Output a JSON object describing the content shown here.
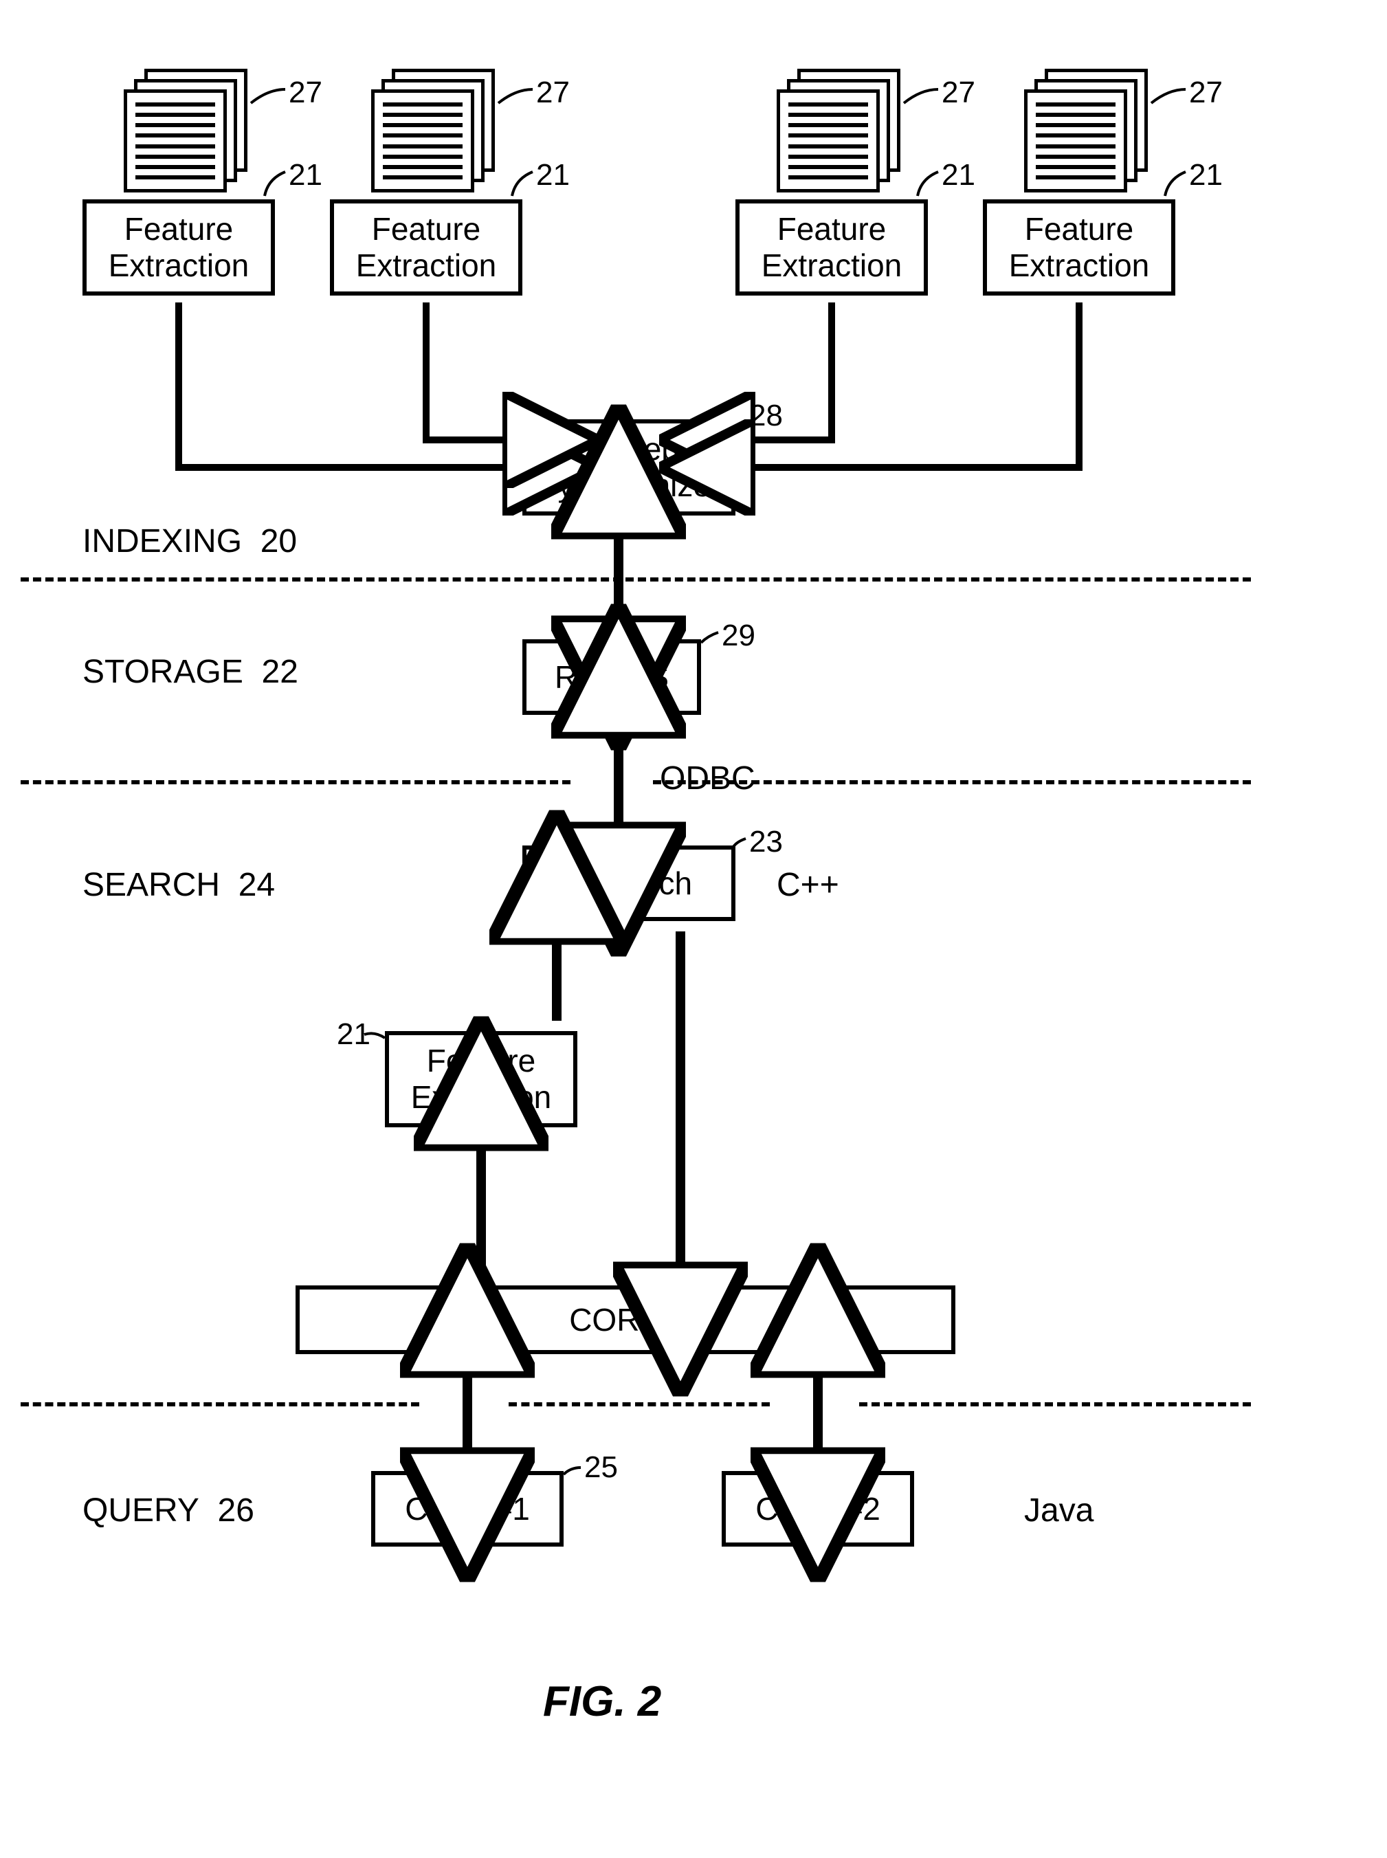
{
  "figure_caption": "FIG. 2",
  "sections": {
    "indexing": {
      "label": "INDEXING",
      "num": "20"
    },
    "storage": {
      "label": "STORAGE",
      "num": "22"
    },
    "search": {
      "label": "SEARCH",
      "num": "24"
    },
    "query": {
      "label": "QUERY",
      "num": "26"
    }
  },
  "boxes": {
    "feature_extraction": "Feature\nExtraction",
    "concept_sync": "Concept\nSynchronizer",
    "rdbms": "RDBMS",
    "ii_search": "II Search",
    "corba": "CORBA",
    "client1": "Client #1",
    "client2": "Client #2"
  },
  "refs": {
    "fe": "21",
    "docs": "27",
    "concept": "28",
    "rdbms": "29",
    "ii": "23",
    "client": "25"
  },
  "annotations": {
    "odbc": "ODBC",
    "cpp": "C++",
    "java": "Java"
  }
}
